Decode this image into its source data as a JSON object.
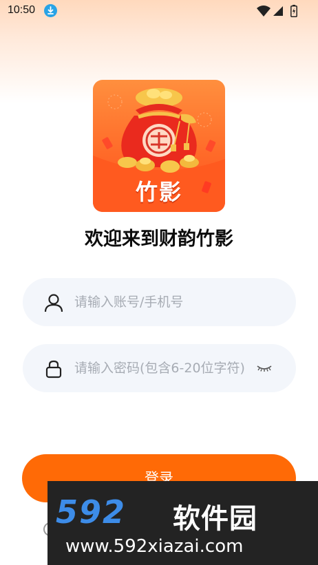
{
  "status_bar": {
    "time": "10:50",
    "icons": [
      "download-icon",
      "wifi-icon",
      "signal-icon",
      "battery-icon"
    ]
  },
  "app": {
    "logo_text": "竹影",
    "welcome": "欢迎来到财韵竹影",
    "accent_color": "#ff6a06"
  },
  "form": {
    "account_placeholder": "请输入账号/手机号",
    "password_placeholder": "请输入密码(包含6-20位字符)",
    "login_label": "登录"
  },
  "watermark": {
    "brand": "592",
    "brand_cn": "软件园",
    "url": "www.592xiazai.com"
  }
}
